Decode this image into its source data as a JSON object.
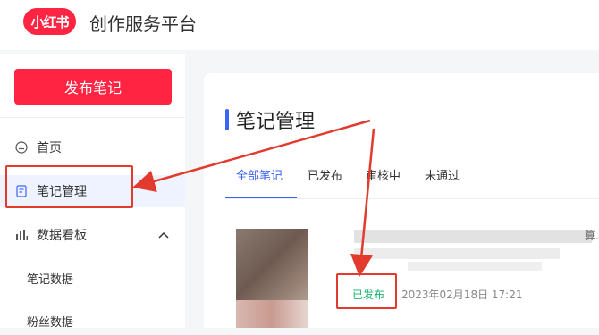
{
  "header": {
    "logo": "小红书",
    "title": "创作服务平台"
  },
  "sidebar": {
    "publish_label": "发布笔记",
    "items": [
      {
        "label": "首页",
        "icon": "home-icon"
      },
      {
        "label": "笔记管理",
        "icon": "note-icon",
        "active": true
      },
      {
        "label": "数据看板",
        "icon": "chart-bars-icon",
        "expanded": true
      }
    ],
    "subitems": [
      {
        "label": "笔记数据"
      },
      {
        "label": "粉丝数据"
      }
    ]
  },
  "main": {
    "title": "笔记管理",
    "tabs": [
      {
        "label": "全部笔记",
        "active": true
      },
      {
        "label": "已发布"
      },
      {
        "label": "审核中"
      },
      {
        "label": "未通过"
      }
    ],
    "note": {
      "title_tail": "算.",
      "status": "已发布",
      "datetime": "2023年02月18日 17:21"
    }
  },
  "colors": {
    "brand": "#ff2442",
    "accent": "#3a64f9",
    "published": "#19b36b",
    "annotation": "#e23b2e"
  }
}
